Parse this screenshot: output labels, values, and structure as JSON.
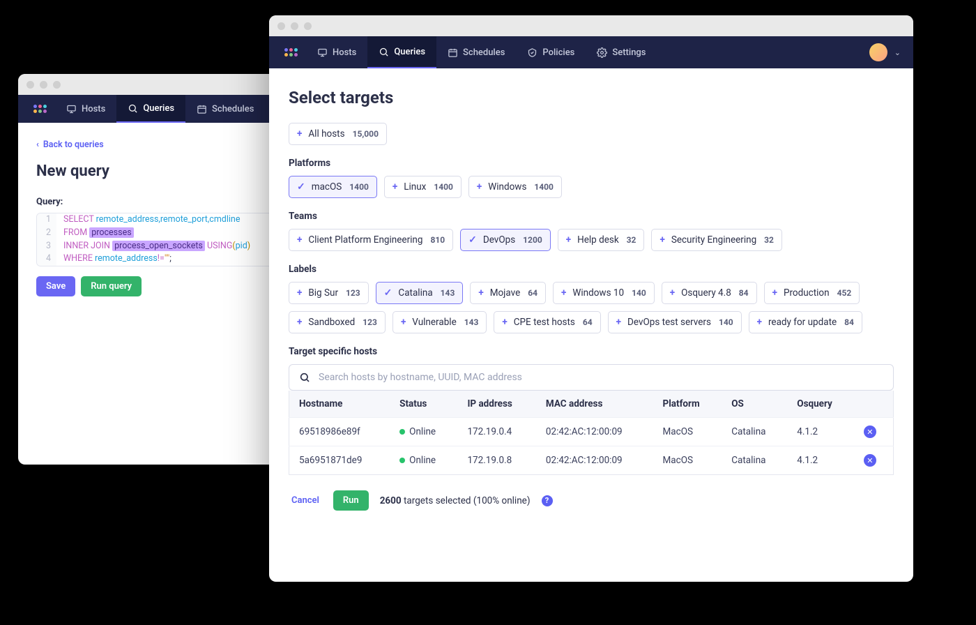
{
  "nav": {
    "hosts": "Hosts",
    "queries": "Queries",
    "schedules": "Schedules",
    "policies": "Policies",
    "settings": "Settings"
  },
  "back_window": {
    "backlink": "Back to queries",
    "title": "New query",
    "query_label": "Query:",
    "code": {
      "l1_select": "SELECT",
      "l1_cols": " remote_address,remote_port,cmdline",
      "l2_from": "FROM",
      "l2_tbl": "processes",
      "l3_join": "INNER JOIN",
      "l3_tbl": "process_open_sockets",
      "l3_using": "USING",
      "l3_col": "pid",
      "l4_where": "WHERE",
      "l4_col": " remote_address",
      "l4_op": "!=",
      "l4_val": "\"\"",
      "l4_semi": ";"
    },
    "save_btn": "Save",
    "run_btn": "Run query"
  },
  "front": {
    "title": "Select targets",
    "all_hosts": {
      "label": "All hosts",
      "count": "15,000"
    },
    "platforms_label": "Platforms",
    "platforms": [
      {
        "label": "macOS",
        "count": "1400",
        "selected": true
      },
      {
        "label": "Linux",
        "count": "1400",
        "selected": false
      },
      {
        "label": "Windows",
        "count": "1400",
        "selected": false
      }
    ],
    "teams_label": "Teams",
    "teams": [
      {
        "label": "Client Platform Engineering",
        "count": "810",
        "selected": false
      },
      {
        "label": "DevOps",
        "count": "1200",
        "selected": true
      },
      {
        "label": "Help desk",
        "count": "32",
        "selected": false
      },
      {
        "label": "Security Engineering",
        "count": "32",
        "selected": false
      }
    ],
    "labels_label": "Labels",
    "labels": [
      {
        "label": "Big Sur",
        "count": "123",
        "selected": false
      },
      {
        "label": "Catalina",
        "count": "143",
        "selected": true
      },
      {
        "label": "Mojave",
        "count": "64",
        "selected": false
      },
      {
        "label": "Windows 10",
        "count": "140",
        "selected": false
      },
      {
        "label": "Osquery 4.8",
        "count": "84",
        "selected": false
      },
      {
        "label": "Production",
        "count": "452",
        "selected": false
      },
      {
        "label": "Sandboxed",
        "count": "123",
        "selected": false
      },
      {
        "label": "Vulnerable",
        "count": "143",
        "selected": false
      },
      {
        "label": "CPE test hosts",
        "count": "64",
        "selected": false
      },
      {
        "label": "DevOps test servers",
        "count": "140",
        "selected": false
      },
      {
        "label": "ready for update",
        "count": "84",
        "selected": false
      }
    ],
    "tsh_label": "Target specific hosts",
    "search_placeholder": "Search hosts by hostname, UUID, MAC address",
    "cols": {
      "hostname": "Hostname",
      "status": "Status",
      "ip": "IP address",
      "mac": "MAC address",
      "platform": "Platform",
      "os": "OS",
      "osquery": "Osquery"
    },
    "rows": [
      {
        "hostname": "69518986e89f",
        "status": "Online",
        "ip": "172.19.0.4",
        "mac": "02:42:AC:12:00:09",
        "platform": "MacOS",
        "os": "Catalina",
        "osquery": "4.1.2"
      },
      {
        "hostname": "5a6951871de9",
        "status": "Online",
        "ip": "172.19.0.8",
        "mac": "02:42:AC:12:00:09",
        "platform": "MacOS",
        "os": "Catalina",
        "osquery": "4.1.2"
      }
    ],
    "cancel": "Cancel",
    "run": "Run",
    "targets_count": "2600",
    "targets_suffix": " targets selected (100% online)"
  }
}
